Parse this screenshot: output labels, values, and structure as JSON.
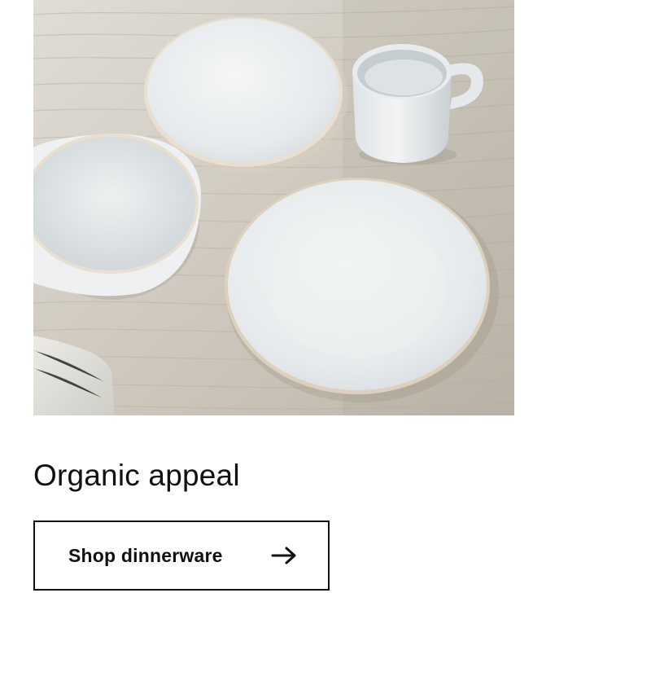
{
  "promo": {
    "image_alt": "White dinnerware set on a wooden table",
    "title": "Organic appeal",
    "cta_label": "Shop dinnerware",
    "cta_icon": "arrow-right-icon"
  },
  "colors": {
    "text": "#111111",
    "background": "#ffffff",
    "button_border": "#111111"
  }
}
